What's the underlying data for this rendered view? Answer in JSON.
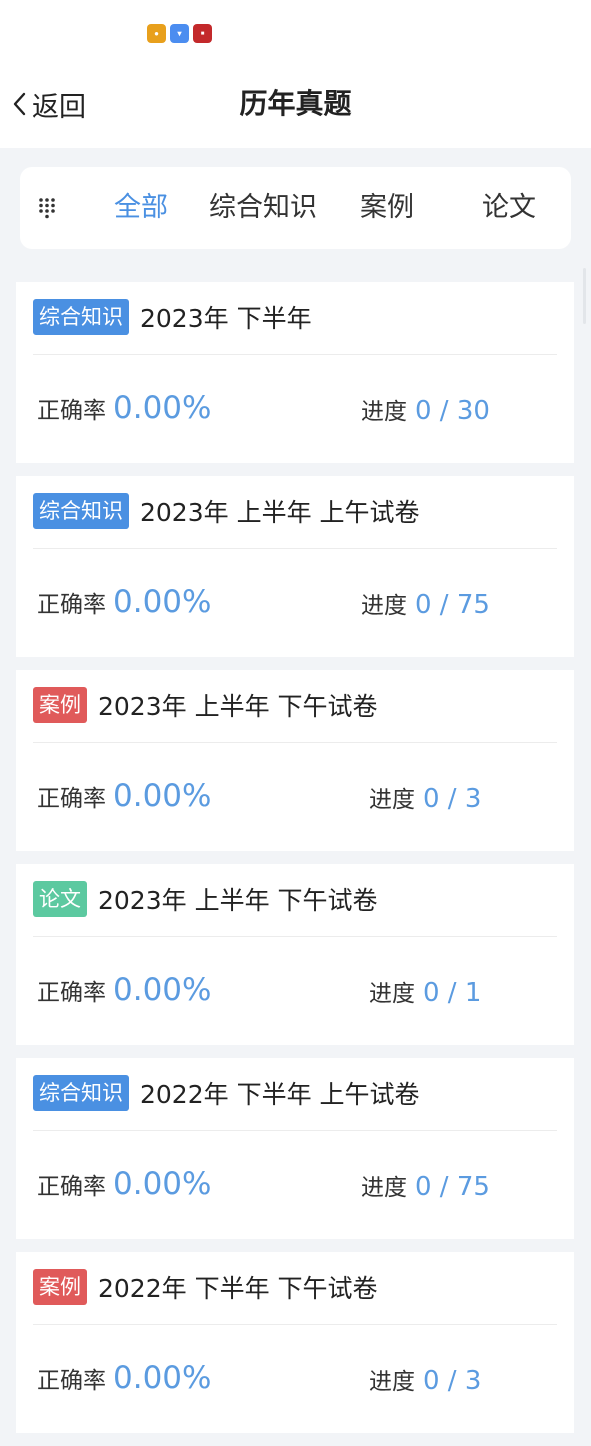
{
  "colors": {
    "accent": "#4a90e2",
    "tag_zonghe": "#4a90e2",
    "tag_anli": "#e05a5a",
    "tag_lunwen": "#5cc9a0"
  },
  "status_icons": [
    "app-icon",
    "app-icon",
    "app-icon"
  ],
  "header": {
    "back_label": "返回",
    "title": "历年真题"
  },
  "tabs": [
    {
      "label": "全部",
      "active": true
    },
    {
      "label": "综合知识",
      "active": false
    },
    {
      "label": "案例",
      "active": false
    },
    {
      "label": "论文",
      "active": false
    }
  ],
  "items": [
    {
      "tag": "综合知识",
      "tag_type": "zonghe",
      "title": "2023年 下半年",
      "accuracy_label": "正确率",
      "accuracy": "0.00%",
      "progress_label": "进度",
      "progress": "0 / 30"
    },
    {
      "tag": "综合知识",
      "tag_type": "zonghe",
      "title": "2023年 上半年 上午试卷",
      "accuracy_label": "正确率",
      "accuracy": "0.00%",
      "progress_label": "进度",
      "progress": "0 / 75"
    },
    {
      "tag": "案例",
      "tag_type": "anli",
      "title": "2023年 上半年 下午试卷",
      "accuracy_label": "正确率",
      "accuracy": "0.00%",
      "progress_label": "进度",
      "progress": "0 / 3"
    },
    {
      "tag": "论文",
      "tag_type": "lunwen",
      "title": "2023年 上半年 下午试卷",
      "accuracy_label": "正确率",
      "accuracy": "0.00%",
      "progress_label": "进度",
      "progress": "0 / 1"
    },
    {
      "tag": "综合知识",
      "tag_type": "zonghe",
      "title": "2022年 下半年 上午试卷",
      "accuracy_label": "正确率",
      "accuracy": "0.00%",
      "progress_label": "进度",
      "progress": "0 / 75"
    },
    {
      "tag": "案例",
      "tag_type": "anli",
      "title": "2022年 下半年 下午试卷",
      "accuracy_label": "正确率",
      "accuracy": "0.00%",
      "progress_label": "进度",
      "progress": "0 / 3"
    }
  ]
}
